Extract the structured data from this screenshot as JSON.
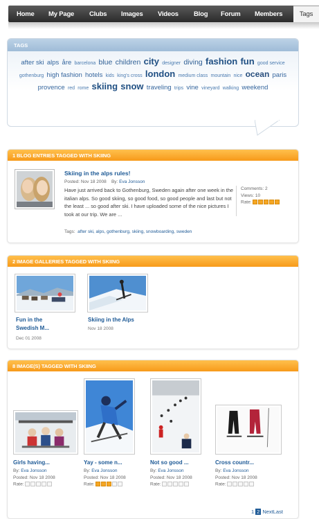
{
  "nav": {
    "items": [
      "Home",
      "My Page",
      "Clubs",
      "Images",
      "Videos",
      "Blog",
      "Forum",
      "Members"
    ],
    "active": "Tags"
  },
  "tags": {
    "title": "TAGS",
    "cloud": [
      {
        "t": "after ski",
        "s": 3
      },
      {
        "t": "alps",
        "s": 3
      },
      {
        "t": "åre",
        "s": 3
      },
      {
        "t": "barcelona",
        "s": 1
      },
      {
        "t": "blue",
        "s": 4
      },
      {
        "t": "children",
        "s": 4
      },
      {
        "t": "city",
        "s": 6
      },
      {
        "t": "designer",
        "s": 1
      },
      {
        "t": "diving",
        "s": 4
      },
      {
        "t": "fashion",
        "s": 6
      },
      {
        "t": "fun",
        "s": 6
      },
      {
        "t": "good service",
        "s": 1
      },
      {
        "t": "gothenburg",
        "s": 1
      },
      {
        "t": "high fashion",
        "s": 3
      },
      {
        "t": "hotels",
        "s": 3
      },
      {
        "t": "kids",
        "s": 1
      },
      {
        "t": "king's cross",
        "s": 1
      },
      {
        "t": "london",
        "s": 6
      },
      {
        "t": "medium class",
        "s": 1
      },
      {
        "t": "mountain",
        "s": 1
      },
      {
        "t": "nice",
        "s": 1
      },
      {
        "t": "ocean",
        "s": 5
      },
      {
        "t": "paris",
        "s": 3
      },
      {
        "t": "provence",
        "s": 3
      },
      {
        "t": "red",
        "s": 1
      },
      {
        "t": "rome",
        "s": 1
      },
      {
        "t": "skiing",
        "s": 6
      },
      {
        "t": "snow",
        "s": 6
      },
      {
        "t": "traveling",
        "s": 3
      },
      {
        "t": "trips",
        "s": 1
      },
      {
        "t": "vine",
        "s": 3
      },
      {
        "t": "vineyard",
        "s": 1
      },
      {
        "t": "walking",
        "s": 1
      },
      {
        "t": "weekend",
        "s": 3
      }
    ]
  },
  "blog": {
    "header": "1 BLOG ENTRIES TAGGED WITH SKIING",
    "title": "Skiing in the alps rules!",
    "posted_label": "Posted: Nov 18 2008",
    "by_label": "By:",
    "author": "Eva Jonsson",
    "body": "Have just arrived back to Gothenburg, Sweden again after one week in the italian alps. So good skiing, so good food, so good people and last but not the least ... so good after ski. I have uploaded some of the nice pictures I took at our trip. We are ...",
    "comments": "Comments: 2",
    "views": "Views: 10",
    "rate_label": "Rate:",
    "rating": 5,
    "tags_label": "Tags:",
    "tags": "after ski, alps, gothenburg, skiing, snowboarding, sweden"
  },
  "galleries": {
    "header": "2 IMAGE GALLERIES TAGGED WITH SKIING",
    "items": [
      {
        "title_line1": "Fun in the",
        "title_line2": "Swedish M...",
        "date": "Dec 01 2008"
      },
      {
        "title_line1": "Skiing in the Alps",
        "title_line2": "",
        "date": "Nov 18 2008"
      }
    ]
  },
  "images": {
    "header": "8 IMAGE(S) TAGGED WITH SKIING",
    "items": [
      {
        "title": "Girls having...",
        "by": "By:",
        "author": "Eva Jonsson",
        "posted": "Posted: Nov 18 2008",
        "rate_label": "Rate:",
        "rating": 0
      },
      {
        "title": "Yay - some n...",
        "by": "By:",
        "author": "Eva Jonsson",
        "posted": "Posted: Nov 18 2008",
        "rate_label": "Rate:",
        "rating": 3
      },
      {
        "title": "Not so good ...",
        "by": "By:",
        "author": "Eva Jonsson",
        "posted": "Posted: Nov 18 2008",
        "rate_label": "Rate:",
        "rating": 0
      },
      {
        "title": "Cross countr...",
        "by": "By:",
        "author": "Eva Jonsson",
        "posted": "Posted: Nov 18 2008",
        "rate_label": "Rate:",
        "rating": 0
      }
    ]
  },
  "pager": {
    "page1": "1",
    "page2": "2",
    "next": "Next",
    "last": "Last"
  },
  "colors": {
    "accent_orange": "#f79a1a",
    "link_blue": "#1e5a96",
    "tag_header_blue": "#a9c4de"
  }
}
